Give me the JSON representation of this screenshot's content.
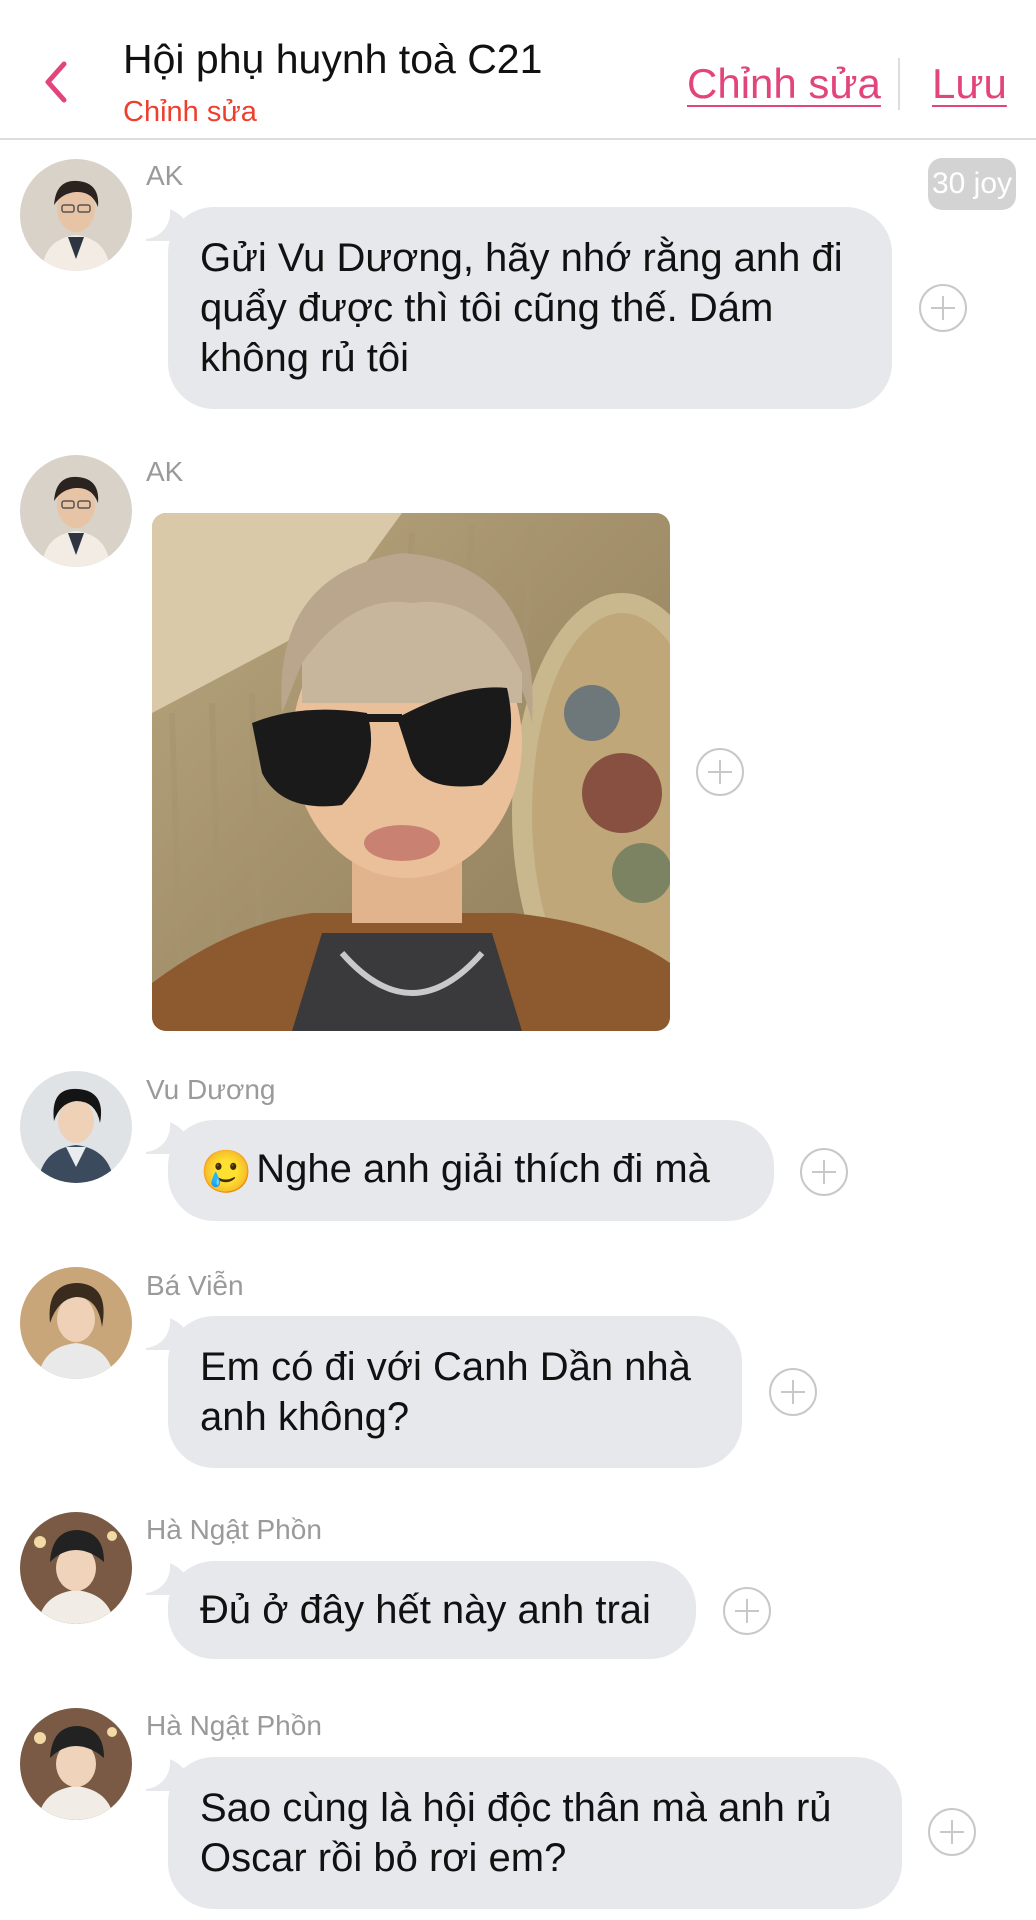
{
  "header": {
    "title": "Hội phụ huynh toà C21",
    "subtitle": "Chỉnh sửa",
    "edit_label": "Chỉnh sửa",
    "save_label": "Lưu"
  },
  "accent_color": "#e2457c",
  "subtitle_color": "#ee3f2d",
  "messages": [
    {
      "sender": "AK",
      "text": "Gửi Vu Dương, hãy nhớ rằng anh đi quẩy được thì tôi cũng thế. Dám không rủ tôi",
      "badge": "30 joy"
    },
    {
      "sender": "AK",
      "type": "image",
      "image_alt": "selfie-photo"
    },
    {
      "sender": "Vu Dương",
      "emoji": "🥲",
      "text": "Nghe anh giải thích đi mà"
    },
    {
      "sender": "Bá Viễn",
      "text": "Em có đi với Canh Dần nhà anh không?"
    },
    {
      "sender": "Hà Ngật Phồn",
      "text": "Đủ ở đây hết này anh trai"
    },
    {
      "sender": "Hà Ngật Phồn",
      "text": "Sao cùng là hội độc thân mà anh rủ Oscar rồi bỏ rơi em?"
    }
  ]
}
